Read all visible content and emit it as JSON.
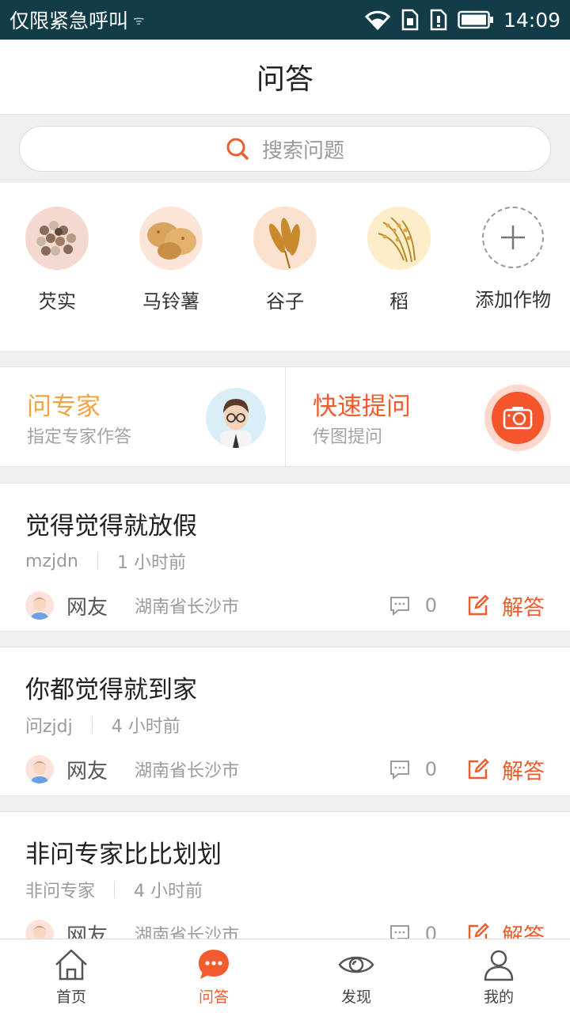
{
  "status_bar": {
    "carrier": "仅限紧急呼叫",
    "time": "14:09"
  },
  "header": {
    "title": "问答"
  },
  "search": {
    "placeholder": "搜索问题"
  },
  "crops": [
    {
      "label": "芡实",
      "icon": "fox-nut-seeds-icon"
    },
    {
      "label": "马铃薯",
      "icon": "potato-icon"
    },
    {
      "label": "谷子",
      "icon": "millet-icon"
    },
    {
      "label": "稻",
      "icon": "rice-icon"
    },
    {
      "label": "添加作物",
      "icon": "plus-icon"
    }
  ],
  "actions": {
    "expert": {
      "title": "问专家",
      "subtitle": "指定专家作答"
    },
    "quick": {
      "title": "快速提问",
      "subtitle": "传图提问"
    }
  },
  "questions": [
    {
      "title": "觉得觉得就放假",
      "author": "mzjdn",
      "time": "1 小时前",
      "nickname": "网友",
      "location": "湖南省长沙市",
      "comments": "0",
      "answer_label": "解答"
    },
    {
      "title": "你都觉得就到家",
      "author": "问zjdj",
      "time": "4 小时前",
      "nickname": "网友",
      "location": "湖南省长沙市",
      "comments": "0",
      "answer_label": "解答"
    },
    {
      "title": "非问专家比比划划",
      "author": "非问专家",
      "time": "4 小时前",
      "nickname": "网友",
      "location": "湖南省长沙市",
      "comments": "0",
      "answer_label": "解答"
    }
  ],
  "tabs": [
    {
      "label": "首页",
      "icon": "home-icon",
      "active": false
    },
    {
      "label": "问答",
      "icon": "chat-bubble-icon",
      "active": true
    },
    {
      "label": "发现",
      "icon": "eye-icon",
      "active": false
    },
    {
      "label": "我的",
      "icon": "person-icon",
      "active": false
    }
  ],
  "colors": {
    "accent": "#f35b2f",
    "expert": "#f5a341",
    "statusbar": "#123d48"
  }
}
